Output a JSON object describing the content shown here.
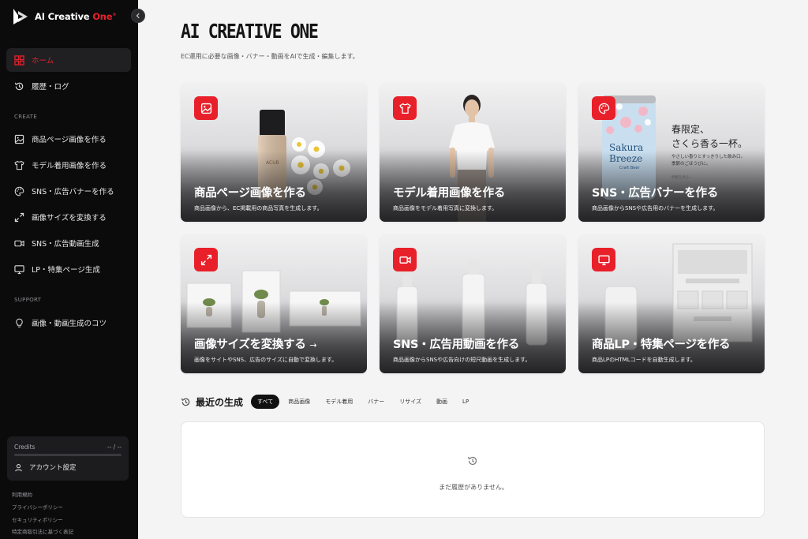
{
  "brand": {
    "name_main": "AI Creative ",
    "name_accent": "One",
    "mark": "®"
  },
  "nav": {
    "home": "ホーム",
    "history": "履歴・ログ",
    "create_label": "CREATE",
    "create_items": [
      "商品ページ画像を作る",
      "モデル着用画像を作る",
      "SNS・広告バナーを作る",
      "画像サイズを変換する",
      "SNS・広告動画生成",
      "LP・特集ページ生成"
    ],
    "support_label": "SUPPORT",
    "support_items": [
      "画像・動画生成のコツ"
    ]
  },
  "credits": {
    "label": "Credits",
    "value": "-- / --",
    "account": "アカウント設定"
  },
  "footer_links": [
    "利用規約",
    "プライバシーポリシー",
    "セキュリティポリシー",
    "特定商取引法に基づく表記"
  ],
  "page": {
    "title": "AI CREATIVE ONE",
    "subtitle": "EC運用に必要な画像・バナー・動画をAIで生成・編集します。"
  },
  "cards": [
    {
      "title": "商品ページ画像を作る",
      "desc": "商品画像から、EC掲載用の商品写真を生成します。",
      "icon": "image-icon"
    },
    {
      "title": "モデル着用画像を作る",
      "desc": "商品画像をモデル着用写真に変換します。",
      "icon": "tshirt-icon"
    },
    {
      "title": "SNS・広告バナーを作る",
      "desc": "商品画像からSNSや広告用のバナーを生成します。",
      "icon": "palette-icon"
    },
    {
      "title": "画像サイズを変換する",
      "arrow": "→",
      "desc": "画像をサイトやSNS、広告のサイズに自動で変換します。",
      "icon": "expand-icon"
    },
    {
      "title": "SNS・広告用動画を作る",
      "desc": "商品画像からSNSや広告向けの短尺動画を生成します。",
      "icon": "video-icon"
    },
    {
      "title": "商品LP・特集ページを作る",
      "desc": "商品LPのHTMLコードを自動生成します。",
      "icon": "monitor-icon"
    }
  ],
  "banner_art": {
    "can_line1": "Sakura",
    "can_line2": "Breeze",
    "can_line3": "Craft Beer",
    "headline1": "春限定、",
    "headline2": "さくら香る一杯。",
    "body1": "やさしい香りとすっきりした飲み口。",
    "body2": "季節のごほうびに。",
    "small": "特集を見る ›",
    "bottle_label": "ACUB"
  },
  "recent": {
    "title": "最近の生成",
    "filters": [
      "すべて",
      "商品画像",
      "モデル着用",
      "バナー",
      "リサイズ",
      "動画",
      "LP"
    ],
    "empty": "まだ履歴がありません。"
  },
  "colors": {
    "accent": "#e8202a",
    "sidebar_bg": "#0b0b0c",
    "page_bg": "#f4f4f5"
  }
}
